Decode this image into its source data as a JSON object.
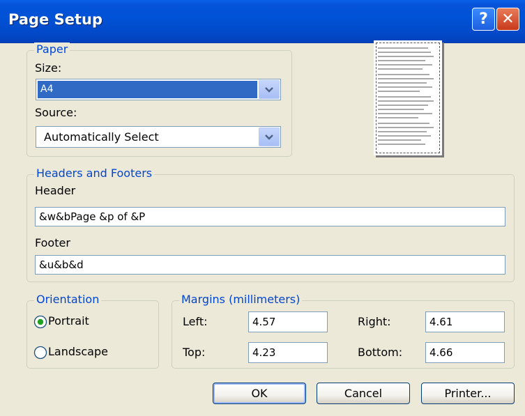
{
  "window": {
    "title": "Page Setup"
  },
  "titlebar": {
    "help_label": "?",
    "close_label": "✕"
  },
  "paper": {
    "legend": "Paper",
    "size_label": "Size:",
    "size_value": "A4",
    "source_label": "Source:",
    "source_value": "Automatically Select"
  },
  "headers_footers": {
    "legend": "Headers and Footers",
    "header_label": "Header",
    "header_value": "&w&bPage &p of &P",
    "footer_label": "Footer",
    "footer_value": "&u&b&d"
  },
  "orientation": {
    "legend": "Orientation",
    "options": [
      {
        "label": "Portrait",
        "selected": true
      },
      {
        "label": "Landscape",
        "selected": false
      }
    ]
  },
  "margins": {
    "legend": "Margins (millimeters)",
    "left_label": "Left:",
    "left_value": "4.57",
    "right_label": "Right:",
    "right_value": "4.61",
    "top_label": "Top:",
    "top_value": "4.23",
    "bottom_label": "Bottom:",
    "bottom_value": "4.66"
  },
  "buttons": {
    "ok": "OK",
    "cancel": "Cancel",
    "printer": "Printer..."
  },
  "colors": {
    "titlebar": "#0052D6",
    "legend": "#0046D5",
    "selection": "#316AC5",
    "face": "#ECE9D8"
  },
  "icons": [
    "help-icon",
    "close-icon",
    "chevron-down-icon",
    "page-preview-icon",
    "radio-checked-icon",
    "radio-unchecked-icon"
  ]
}
